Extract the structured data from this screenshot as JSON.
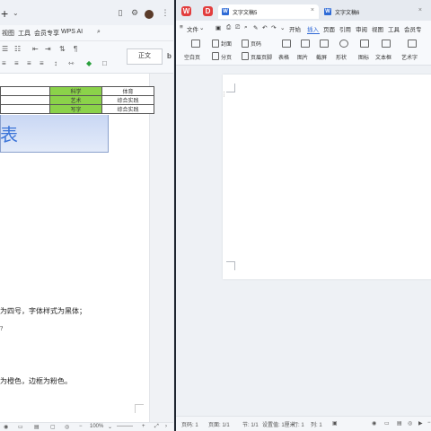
{
  "left_window": {
    "menu": [
      "视图",
      "工具",
      "会员专享",
      "WPS AI"
    ],
    "style_box": "正文",
    "table": {
      "row1": [
        "科学",
        "体育"
      ],
      "row2": [
        "艺术",
        "综合实践"
      ],
      "row3": [
        "写字",
        "综合实践"
      ]
    },
    "big_title": "表",
    "text1": "为四号，字体样式为黑体；",
    "text2": "?",
    "text3": "为橙色，边框为粉色。",
    "status_zoom": "100%"
  },
  "right_window": {
    "tabs": [
      {
        "label": "文字文稿5"
      },
      {
        "label": "文字文稿6"
      }
    ],
    "menu": {
      "file": "文件",
      "start": "开始",
      "insert": "插入",
      "page": "页面",
      "reference": "引用",
      "review": "审阅",
      "view": "视图",
      "tools": "工具",
      "member": "会员专"
    },
    "ribbon": {
      "cover": "封面",
      "page": "页码",
      "blank_page": "空白页",
      "section": "分页",
      "header_footer": "页眉页脚",
      "table": "表格",
      "image": "图片",
      "screenshot": "截屏",
      "shape": "形状",
      "icon": "图标",
      "textbox": "文本框",
      "art": "艺术字"
    },
    "status": {
      "page": "页码: 1",
      "pages": "页面: 1/1",
      "section": "节: 1/1",
      "setting": "设置值: 1厘米",
      "row": "行: 1",
      "col": "列: 1"
    }
  }
}
